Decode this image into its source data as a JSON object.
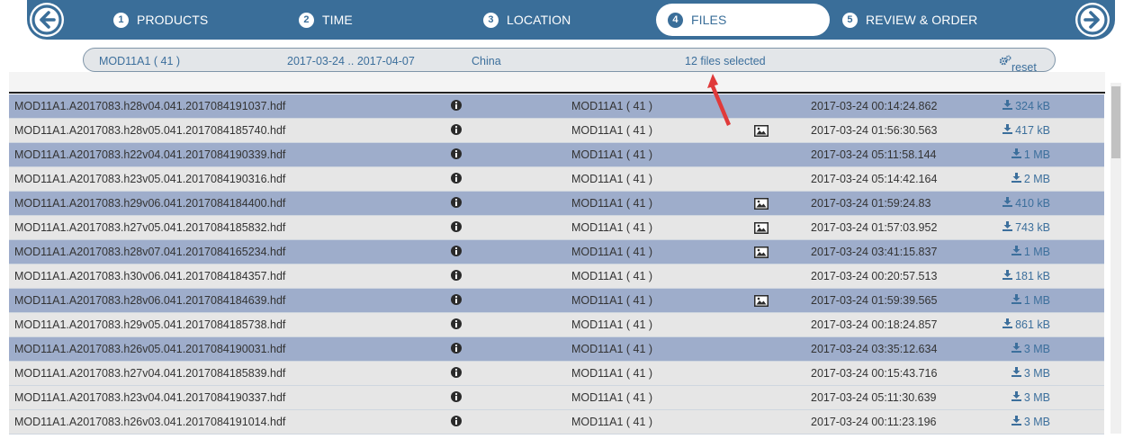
{
  "wizard": {
    "prev_label": "Previous step",
    "next_label": "Next step",
    "steps": [
      {
        "num": "1",
        "label": "PRODUCTS"
      },
      {
        "num": "2",
        "label": "TIME"
      },
      {
        "num": "3",
        "label": "LOCATION"
      },
      {
        "num": "4",
        "label": "FILES",
        "active": true
      },
      {
        "num": "5",
        "label": "REVIEW & ORDER"
      }
    ]
  },
  "summary": {
    "product": "MOD11A1 ( 41 )",
    "date_range": "2017-03-24 .. 2017-04-07",
    "location": "China",
    "files_selected": "12 files selected",
    "reset_label": "reset"
  },
  "colors": {
    "brand": "#3a6e99",
    "highlight_row": "#9eadcb",
    "plain_row": "#e6e6e6",
    "link": "#3c6f9c",
    "annotation_arrow": "#e03a3a"
  },
  "icons": {
    "prev": "arrow-left-circle-icon",
    "next": "arrow-right-circle-icon",
    "info": "info-circle-icon",
    "thumbnail": "image-icon",
    "download": "download-icon",
    "reset": "gears-icon"
  },
  "files": [
    {
      "name": "MOD11A1.A2017083.h28v04.041.2017084191037.hdf",
      "product": "MOD11A1 ( 41 )",
      "thumb": false,
      "date": "2017-03-24 00:14:24.862",
      "size": "324 kB",
      "selected": true
    },
    {
      "name": "MOD11A1.A2017083.h28v05.041.2017084185740.hdf",
      "product": "MOD11A1 ( 41 )",
      "thumb": true,
      "date": "2017-03-24 01:56:30.563",
      "size": "417 kB",
      "selected": false
    },
    {
      "name": "MOD11A1.A2017083.h22v04.041.2017084190339.hdf",
      "product": "MOD11A1 ( 41 )",
      "thumb": false,
      "date": "2017-03-24 05:11:58.144",
      "size": "1 MB",
      "selected": true
    },
    {
      "name": "MOD11A1.A2017083.h23v05.041.2017084190316.hdf",
      "product": "MOD11A1 ( 41 )",
      "thumb": false,
      "date": "2017-03-24 05:14:42.164",
      "size": "2 MB",
      "selected": false
    },
    {
      "name": "MOD11A1.A2017083.h29v06.041.2017084184400.hdf",
      "product": "MOD11A1 ( 41 )",
      "thumb": true,
      "date": "2017-03-24 01:59:24.83",
      "size": "410 kB",
      "selected": true
    },
    {
      "name": "MOD11A1.A2017083.h27v05.041.2017084185832.hdf",
      "product": "MOD11A1 ( 41 )",
      "thumb": true,
      "date": "2017-03-24 01:57:03.952",
      "size": "743 kB",
      "selected": false
    },
    {
      "name": "MOD11A1.A2017083.h28v07.041.2017084165234.hdf",
      "product": "MOD11A1 ( 41 )",
      "thumb": true,
      "date": "2017-03-24 03:41:15.837",
      "size": "1 MB",
      "selected": true
    },
    {
      "name": "MOD11A1.A2017083.h30v06.041.2017084184357.hdf",
      "product": "MOD11A1 ( 41 )",
      "thumb": false,
      "date": "2017-03-24 00:20:57.513",
      "size": "181 kB",
      "selected": false
    },
    {
      "name": "MOD11A1.A2017083.h28v06.041.2017084184639.hdf",
      "product": "MOD11A1 ( 41 )",
      "thumb": true,
      "date": "2017-03-24 01:59:39.565",
      "size": "1 MB",
      "selected": true
    },
    {
      "name": "MOD11A1.A2017083.h29v05.041.2017084185738.hdf",
      "product": "MOD11A1 ( 41 )",
      "thumb": false,
      "date": "2017-03-24 00:18:24.857",
      "size": "861 kB",
      "selected": false
    },
    {
      "name": "MOD11A1.A2017083.h26v05.041.2017084190031.hdf",
      "product": "MOD11A1 ( 41 )",
      "thumb": false,
      "date": "2017-03-24 03:35:12.634",
      "size": "3 MB",
      "selected": true
    },
    {
      "name": "MOD11A1.A2017083.h27v04.041.2017084185839.hdf",
      "product": "MOD11A1 ( 41 )",
      "thumb": false,
      "date": "2017-03-24 00:15:43.716",
      "size": "3 MB",
      "selected": false
    },
    {
      "name": "MOD11A1.A2017083.h23v04.041.2017084190337.hdf",
      "product": "MOD11A1 ( 41 )",
      "thumb": false,
      "date": "2017-03-24 05:11:30.639",
      "size": "3 MB",
      "selected": false
    },
    {
      "name": "MOD11A1.A2017083.h26v03.041.2017084191014.hdf",
      "product": "MOD11A1 ( 41 )",
      "thumb": false,
      "date": "2017-03-24 00:11:23.196",
      "size": "3 MB",
      "selected": false
    }
  ]
}
